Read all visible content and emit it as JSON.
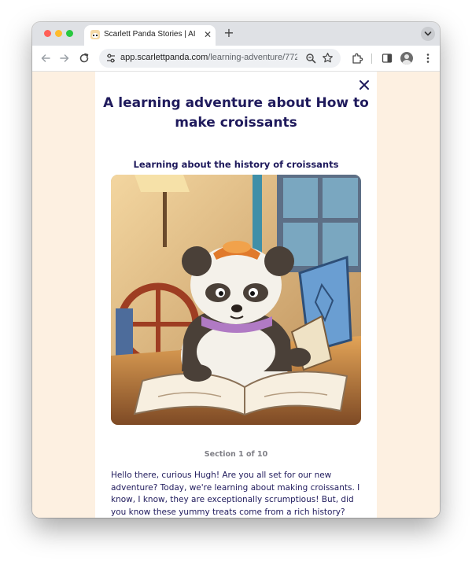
{
  "browser": {
    "tab_title": "Scarlett Panda Stories | AI Ge",
    "tab_close_glyph": "✕",
    "new_tab_glyph": "+",
    "url_domain": "app.scarlettpanda.com",
    "url_path": "/learning-adventure/772"
  },
  "page": {
    "title": "A learning adventure about How to make croissants",
    "section_heading": "Learning about the history of croissants",
    "section_counter": "Section 1 of 10",
    "story_text": "Hello there, curious Hugh! Are you all set for our new adventure? Today, we're learning about making croissants. I know, I know, they are exceptionally scrumptious! But, did you know these yummy treats come from a rich history? Croissants",
    "close_icon": "close-icon"
  },
  "colors": {
    "page_background": "#fdf0e1",
    "heading_text": "#1f1a5c",
    "counter_text": "#7f7f86"
  }
}
